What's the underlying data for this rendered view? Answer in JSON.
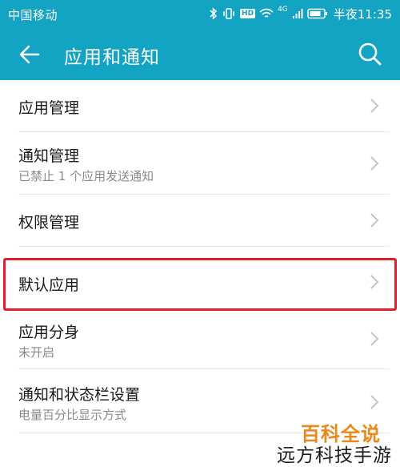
{
  "status_bar": {
    "carrier": "中国移动",
    "hd_badge": "HD",
    "network_badge": "4G",
    "time": "半夜11:35"
  },
  "toolbar": {
    "title": "应用和通知"
  },
  "items": [
    {
      "label": "应用管理",
      "sub": ""
    },
    {
      "label": "通知管理",
      "sub": "已禁止 1 个应用发送通知"
    },
    {
      "label": "权限管理",
      "sub": ""
    },
    {
      "label": "默认应用",
      "sub": ""
    },
    {
      "label": "应用分身",
      "sub": "未开启"
    },
    {
      "label": "通知和状态栏设置",
      "sub": "电量百分比显示方式"
    }
  ],
  "watermark": {
    "top": "百科全说",
    "bottom": "远方科技手游"
  },
  "colors": {
    "header_bg": "#12a4c2",
    "highlight_border": "#e0202a",
    "watermark_orange": "#e8891a"
  }
}
